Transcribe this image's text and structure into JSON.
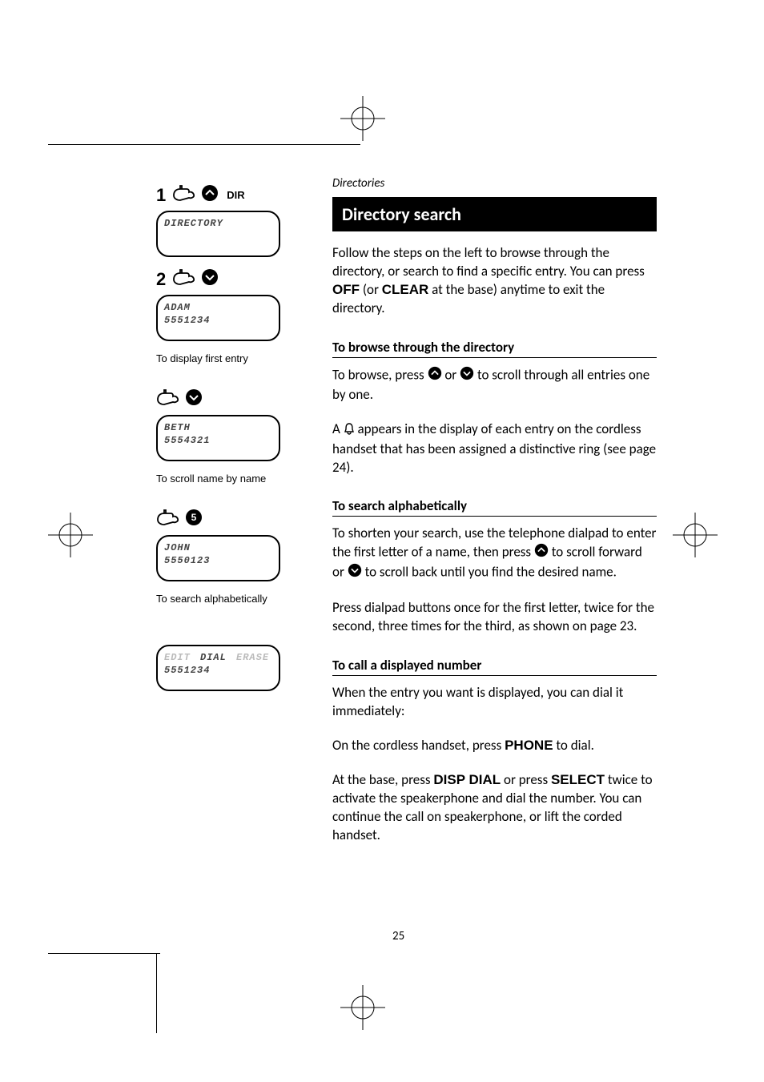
{
  "breadcrumb": "Directories",
  "title": "Directory search",
  "intro": "Follow the steps on the left to browse through the directory, or search to find a specific entry. You can press OFF (or CLEAR at the base) anytime to exit the directory.",
  "intro_parts": {
    "p1": "Follow the steps on the left to browse through the directory, or search to find a specific entry. You can press ",
    "off": "OFF",
    "p2": " (or ",
    "clear": "CLEAR",
    "p3": " at the base) anytime to exit the directory."
  },
  "browse": {
    "heading": "To browse through the directory",
    "p1a": "To browse, press ",
    "p1b": " or ",
    "p1c": " to scroll through all entries one by one.",
    "p2a": "A ",
    "p2b": " appears in the display of each entry on the cord­less handset that has been assigned a distinctive ring (see page 24)."
  },
  "alpha": {
    "heading": "To search alphabetically",
    "p1a": "To shorten your search, use the telephone dialpad to enter the first letter of a name, then press ",
    "p1b": " to scroll forward or ",
    "p1c": " to scroll back until you find the desired name.",
    "p2": "Press dialpad buttons once for the first letter, twice for the second, three times for the third, as shown on page 23."
  },
  "call": {
    "heading": "To call a displayed number",
    "p1": "When the entry you want is displayed, you can dial it immediately:",
    "p2a": "On the cordless handset, press ",
    "phone": "PHONE",
    "p2b": " to dial.",
    "p3a": "At the base, press ",
    "dispdial": "DISP DIAL",
    "p3b": " or press ",
    "select": "SELECT",
    "p3c": " twice to activate the speakerphone and dial the number. You can continue the call on speakerphone, or lift the cord­ed handset."
  },
  "left": {
    "step1": "1",
    "step2": "2",
    "dir": "DIR",
    "lcd1": "DIRECTORY",
    "lcd2a": "ADAM",
    "lcd2b": "5551234",
    "caption2": "To display first entry",
    "lcd3a": "BETH",
    "lcd3b": "5554321",
    "caption3": "To scroll name by name",
    "lcd4a": "JOHN",
    "lcd4b": "5550123",
    "caption4": "To search alphabetically",
    "lcd5_edit": "EDIT",
    "lcd5_dial": "DIAL",
    "lcd5_erase": "ERASE",
    "lcd5b": "5551234"
  },
  "page_number": "25",
  "icons": {
    "key5": "5"
  }
}
